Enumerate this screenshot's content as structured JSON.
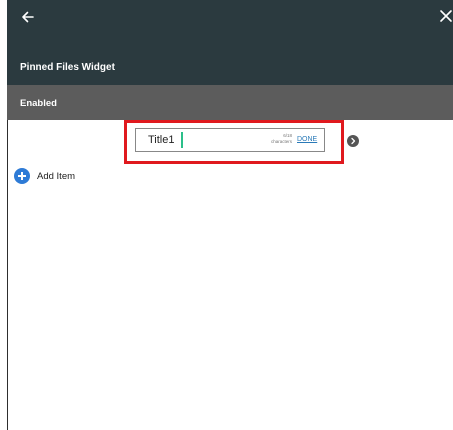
{
  "header": {
    "back_icon": "arrow-left-icon",
    "close_icon": "close-icon",
    "title": "Pinned Files Widget"
  },
  "status_bar": {
    "label": "Enabled"
  },
  "title_editor": {
    "value": "Title1",
    "counter_value": "6/18",
    "counter_label": "characters",
    "done_label": "DONE",
    "next_icon": "chevron-right-icon"
  },
  "add_item": {
    "icon": "plus-circle-icon",
    "label": "Add Item"
  },
  "colors": {
    "header_bg": "#2b3a3f",
    "status_bg": "#5c5c5c",
    "highlight": "#e0191e",
    "accent_blue": "#2e7bd6",
    "caret": "#2bbf8a"
  }
}
